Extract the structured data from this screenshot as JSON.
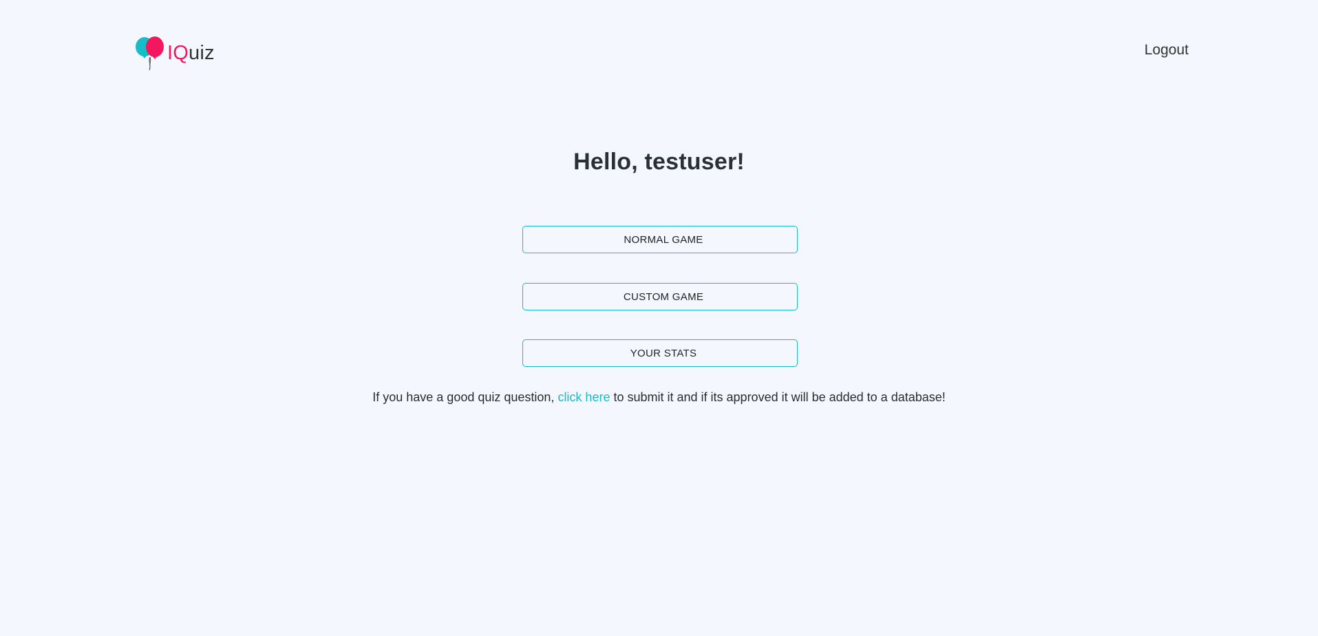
{
  "header": {
    "logo_icon": "balloons-icon",
    "logo_accent": "IQ",
    "logo_rest": "uiz",
    "logout_label": "Logout"
  },
  "main": {
    "greeting": "Hello, testuser!",
    "buttons": [
      {
        "label": "NORMAL GAME"
      },
      {
        "label": "CUSTOM GAME"
      },
      {
        "label": "YOUR STATS"
      }
    ],
    "submit_note": {
      "before": "If you have a good quiz question, ",
      "link": "click here",
      "after": " to submit it and if its approved it will be added to a database!"
    }
  },
  "colors": {
    "background": "#f4f8fe",
    "accent_teal": "#16bcc7",
    "accent_pink": "#f2175f",
    "heading": "#2b3037"
  }
}
